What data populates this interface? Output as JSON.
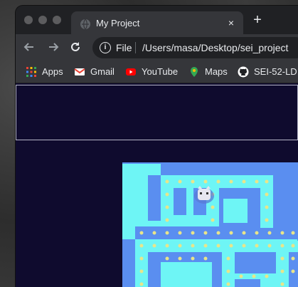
{
  "browser": {
    "tab_title": "My Project",
    "tab_close": "×",
    "new_tab": "+",
    "url_scheme": "File",
    "url": "/Users/masa/Desktop/sei_project"
  },
  "bookmarks": [
    {
      "label": "Apps",
      "icon": "apps-grid-icon"
    },
    {
      "label": "Gmail",
      "icon": "gmail-icon"
    },
    {
      "label": "YouTube",
      "icon": "youtube-icon"
    },
    {
      "label": "Maps",
      "icon": "maps-pin-icon"
    },
    {
      "label": "SEI-52-LD",
      "icon": "github-icon"
    }
  ],
  "colors": {
    "page_bg": "#0f0b2e",
    "board_wall": "#5a8ef0",
    "board_path": "#6ef5f5",
    "pellet": "#e9e58a",
    "tab_bg": "#35363a",
    "titlebar": "#202124"
  }
}
